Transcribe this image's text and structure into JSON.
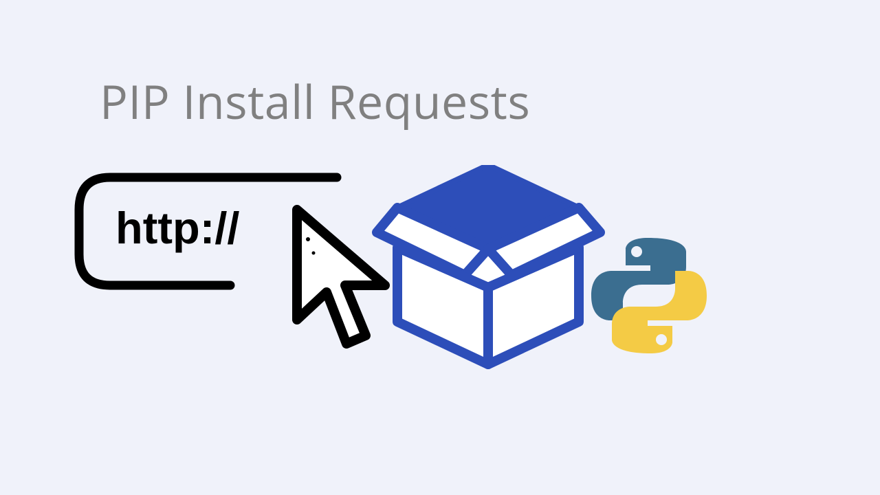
{
  "title": "PIP Install Requests",
  "url_text": "http://",
  "colors": {
    "background": "#f0f2fa",
    "title_color": "#808080",
    "box_color": "#2d4eb9",
    "python_blue": "#3b6e90",
    "python_yellow": "#f4cb45",
    "black": "#000000"
  }
}
